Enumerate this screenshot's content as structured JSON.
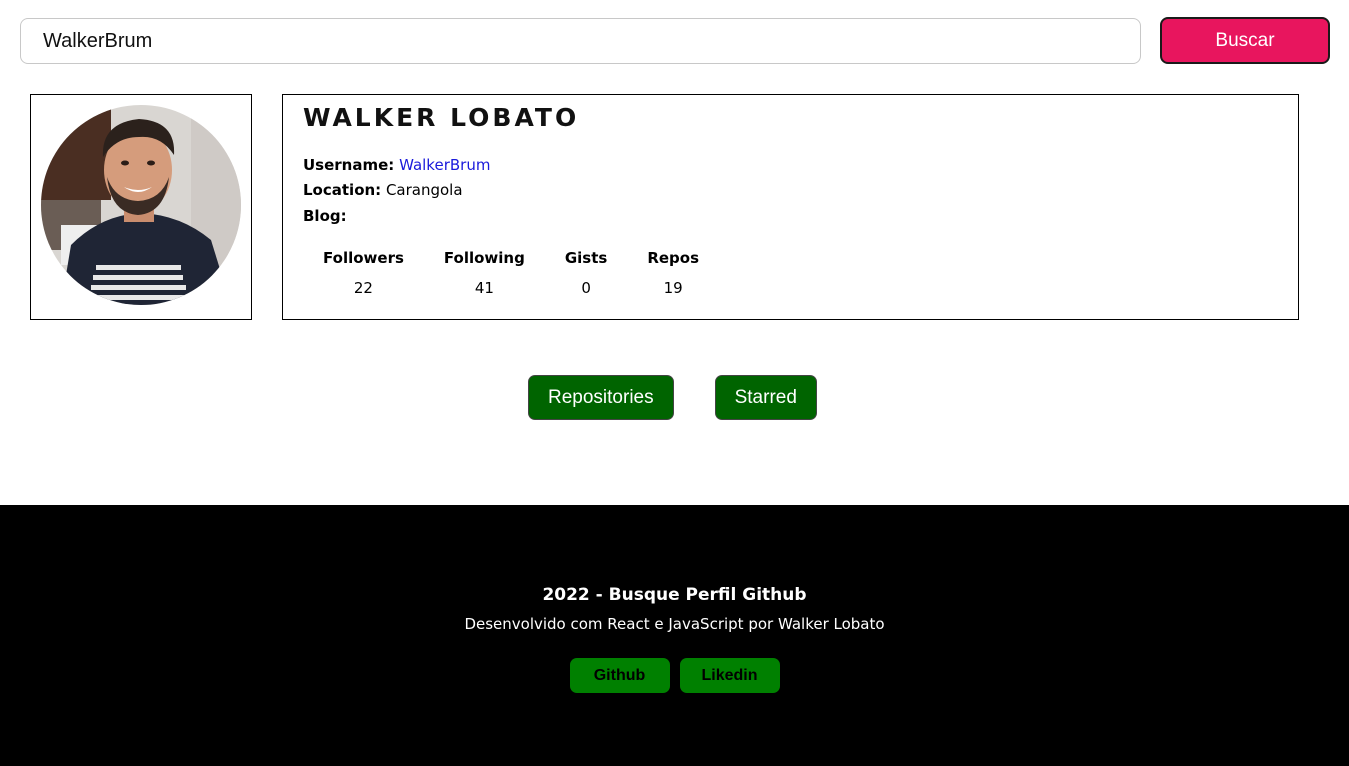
{
  "search": {
    "value": "WalkerBrum",
    "button_label": "Buscar"
  },
  "profile": {
    "name": "WALKER LOBATO",
    "username_label": "Username:",
    "username": "WalkerBrum",
    "location_label": "Location:",
    "location": "Carangola",
    "blog_label": "Blog:",
    "blog": "",
    "stats": [
      {
        "label": "Followers",
        "value": "22"
      },
      {
        "label": "Following",
        "value": "41"
      },
      {
        "label": "Gists",
        "value": "0"
      },
      {
        "label": "Repos",
        "value": "19"
      }
    ]
  },
  "tabs": {
    "repositories": "Repositories",
    "starred": "Starred"
  },
  "footer": {
    "title": "2022 - Busque Perfil Github",
    "subtitle": "Desenvolvido com React e JavaScript por Walker Lobato",
    "links": [
      "Github",
      "Likedin"
    ]
  },
  "colors": {
    "search_button": "#e8155e",
    "tab_button": "#006400",
    "footer_button": "#008000",
    "footer_bg": "#000000",
    "link": "#1a1adb"
  }
}
